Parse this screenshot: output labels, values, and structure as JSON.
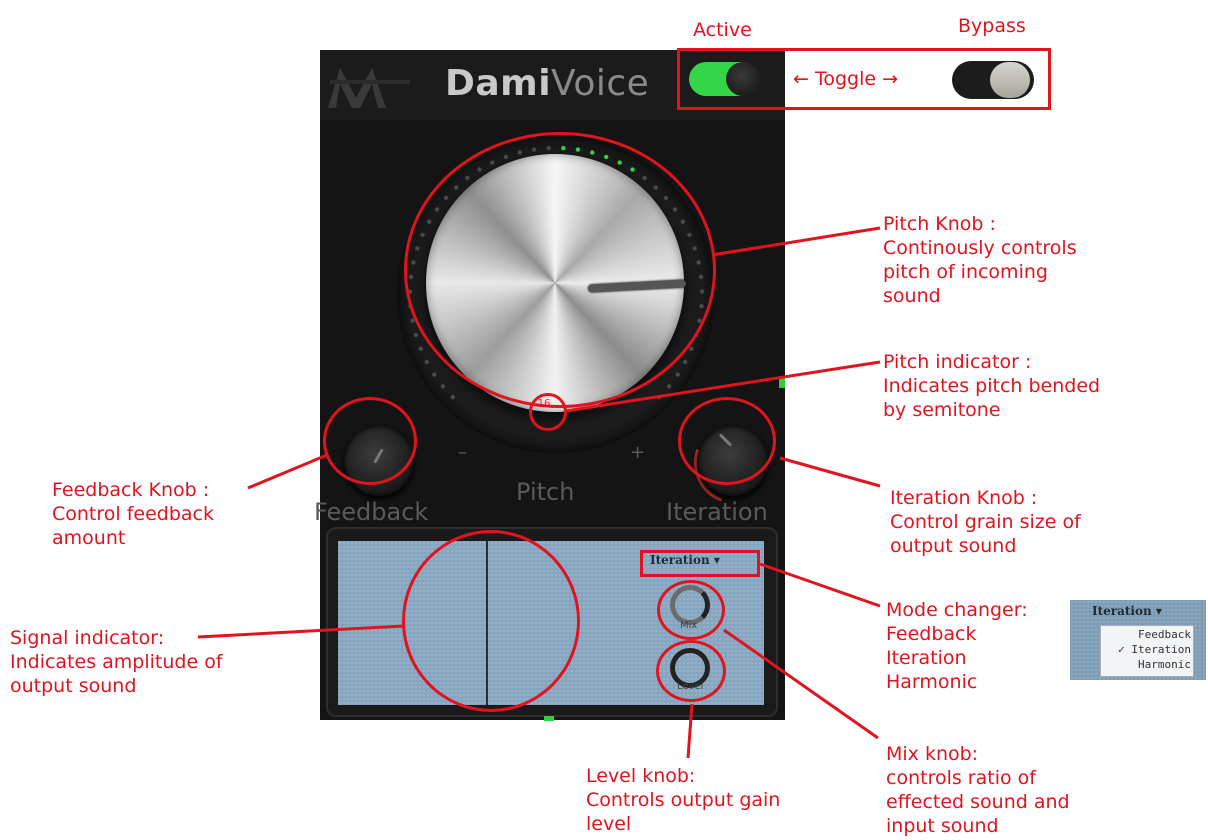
{
  "plugin": {
    "brand_dami": "Dami",
    "brand_voice": "Voice",
    "pitch_value": "16",
    "minus": "–",
    "plus": "+",
    "pitch_label": "Pitch",
    "feedback_label": "Feedback",
    "iteration_label": "Iteration",
    "mode_value": "Iteration ▾",
    "mix_label": "Mix",
    "level_label": "Level",
    "pitch_level": 0.62,
    "toggle_state_on": true
  },
  "annotations": {
    "active": "Active",
    "bypass": "Bypass",
    "toggle": "← Toggle →",
    "pitch_knob": [
      "Pitch Knob :",
      "Continously controls",
      "pitch of incoming",
      "sound"
    ],
    "pitch_indicator": [
      "Pitch indicator :",
      "Indicates pitch bended",
      "by semitone"
    ],
    "feedback_knob": [
      "Feedback Knob :",
      "Control feedback",
      "amount"
    ],
    "iteration_knob": [
      "Iteration Knob :",
      "Control grain size of",
      "output sound"
    ],
    "mode_changer": [
      "Mode changer:",
      "Feedback",
      "Iteration",
      "Harmonic"
    ],
    "signal_indicator": [
      "Signal indicator:",
      "Indicates amplitude of",
      "output sound"
    ],
    "level_knob": [
      "Level knob:",
      "Controls output gain",
      "level"
    ],
    "mix_knob": [
      "Mix knob:",
      "controls ratio of",
      "effected sound and",
      "input sound"
    ]
  },
  "mode_inset": {
    "header": "Iteration ▾",
    "options": [
      "Feedback",
      "✓ Iteration",
      "Harmonic"
    ]
  },
  "colors": {
    "annotation_red": "#e0141e",
    "active_green": "#33d646",
    "panel_dark": "#141414",
    "display_blue": "#87a5bf"
  }
}
